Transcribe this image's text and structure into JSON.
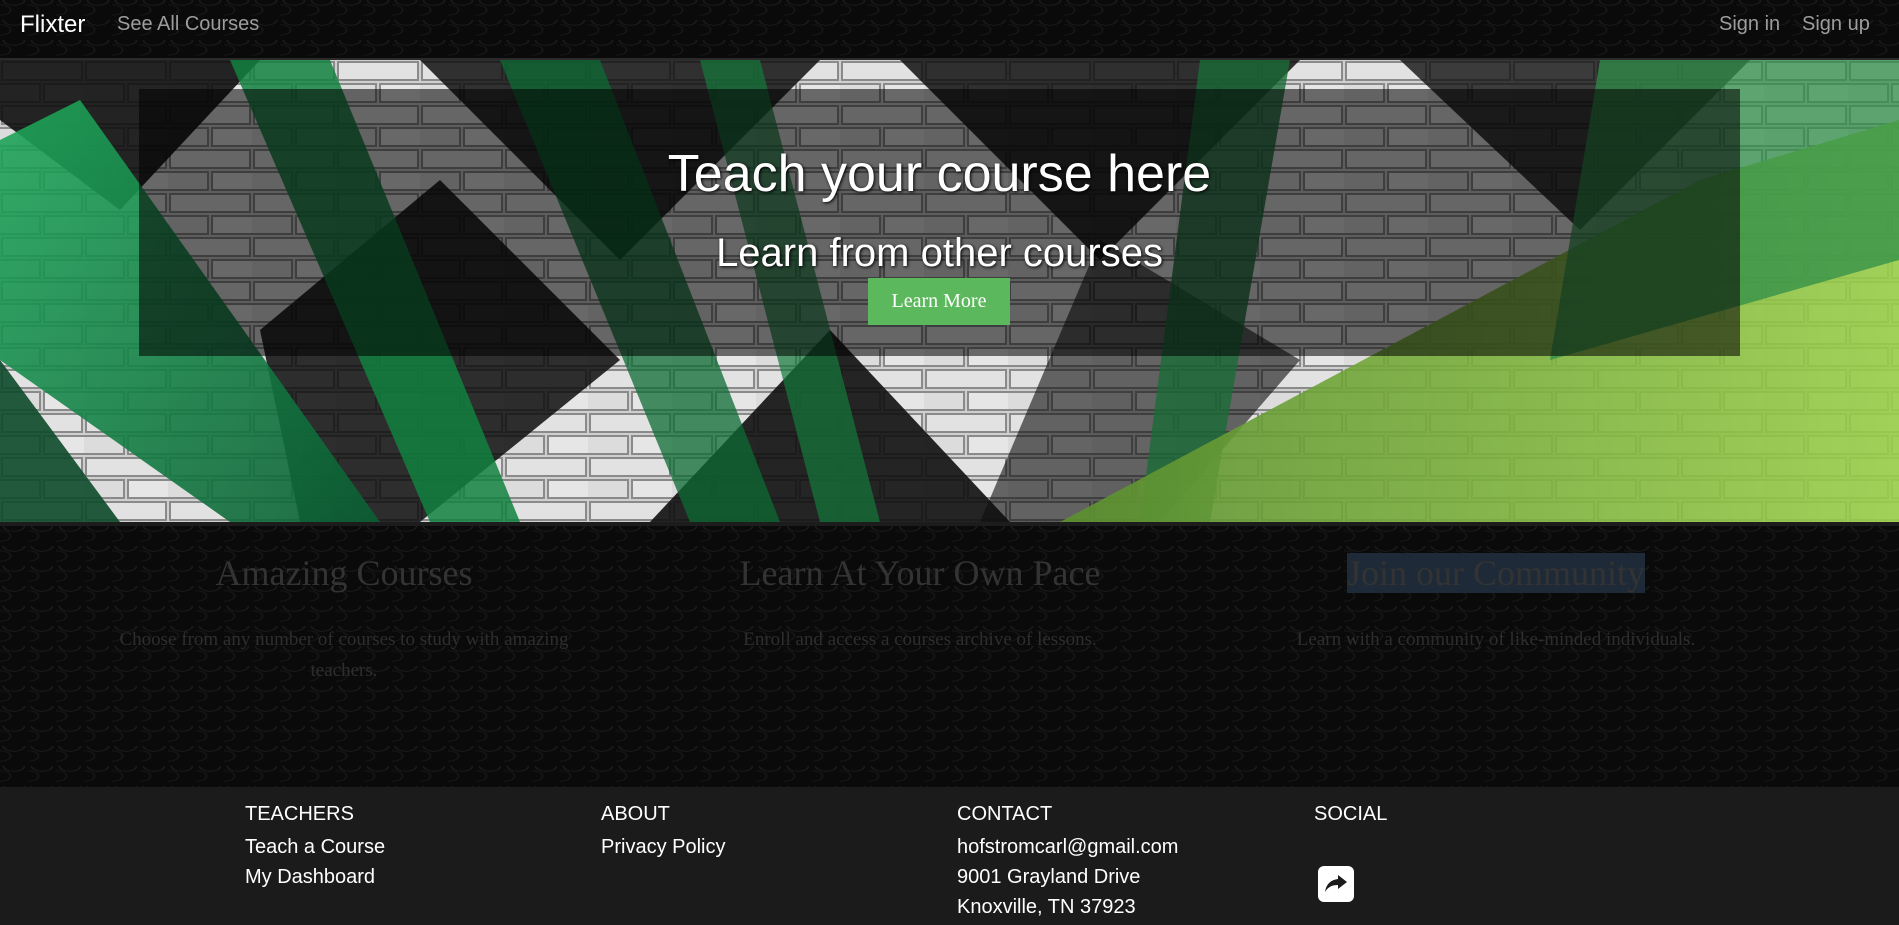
{
  "navbar": {
    "brand": "Flixter",
    "see_all_courses": "See All Courses",
    "sign_in": "Sign in",
    "sign_up": "Sign up"
  },
  "hero": {
    "title": "Teach your course here",
    "subtitle": "Learn from other courses",
    "button_label": "Learn More",
    "button_color": "#5cb85c"
  },
  "features": [
    {
      "title": "Amazing Courses",
      "text": "Choose from any number of courses to study with amazing teachers."
    },
    {
      "title": "Learn At Your Own Pace",
      "text": "Enroll and access a courses archive of lessons."
    },
    {
      "title": "Join our Community",
      "text": "Learn with a community of like-minded individuals."
    }
  ],
  "footer": {
    "teachers": {
      "heading": "TEACHERS",
      "items": [
        "Teach a Course",
        "My Dashboard"
      ]
    },
    "about": {
      "heading": "ABOUT",
      "items": [
        "Privacy Policy"
      ]
    },
    "contact": {
      "heading": "CONTACT",
      "items": [
        "hofstromcarl@gmail.com",
        "9001 Grayland Drive",
        "Knoxville, TN 37923"
      ]
    },
    "social": {
      "heading": "SOCIAL",
      "icon": "share-square-icon"
    }
  }
}
